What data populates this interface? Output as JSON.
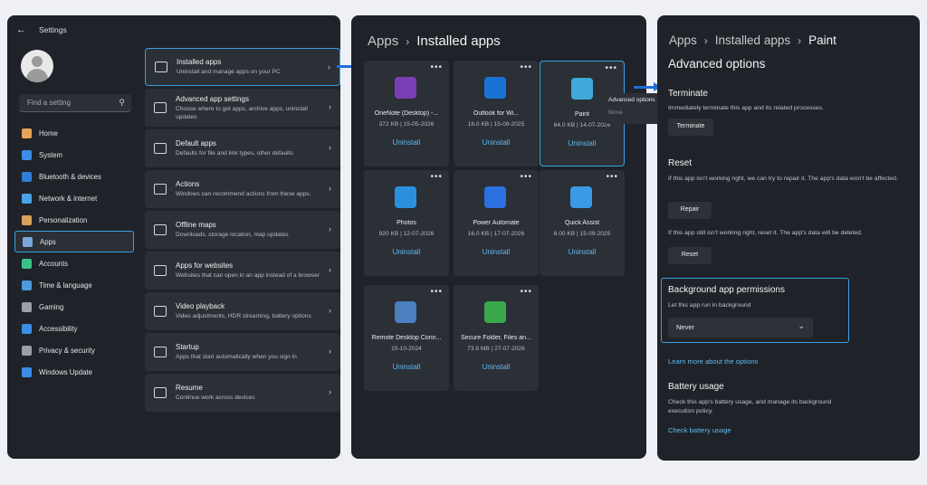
{
  "settings": {
    "back_icon": "back-arrow-icon",
    "title": "Settings",
    "search_placeholder": "Find a setting",
    "nav": [
      {
        "label": "Home",
        "icon": "home-icon",
        "color": "#e8a35a"
      },
      {
        "label": "System",
        "icon": "monitor-icon",
        "color": "#3a8ee6"
      },
      {
        "label": "Bluetooth & devices",
        "icon": "bluetooth-icon",
        "color": "#2f7fd8"
      },
      {
        "label": "Network & internet",
        "icon": "wifi-icon",
        "color": "#4aa3e8"
      },
      {
        "label": "Personalization",
        "icon": "brush-icon",
        "color": "#d9a25a"
      },
      {
        "label": "Apps",
        "icon": "apps-icon",
        "color": "#7aa6d8",
        "active": true
      },
      {
        "label": "Accounts",
        "icon": "person-icon",
        "color": "#3cc08a"
      },
      {
        "label": "Time & language",
        "icon": "globe-clock-icon",
        "color": "#4a9be0"
      },
      {
        "label": "Gaming",
        "icon": "controller-icon",
        "color": "#9aa0aa"
      },
      {
        "label": "Accessibility",
        "icon": "accessibility-icon",
        "color": "#3a8ee6"
      },
      {
        "label": "Privacy & security",
        "icon": "shield-icon",
        "color": "#9aa0aa"
      },
      {
        "label": "Windows Update",
        "icon": "update-icon",
        "color": "#3a8ee6"
      }
    ],
    "cards": [
      {
        "title": "Installed apps",
        "desc": "Uninstall and manage apps on your PC",
        "icon": "list-icon",
        "selected": true
      },
      {
        "title": "Advanced app settings",
        "desc": "Choose where to get apps, archive apps, uninstall updates",
        "icon": "app-settings-icon"
      },
      {
        "title": "Default apps",
        "desc": "Defaults for file and link types, other defaults",
        "icon": "default-apps-icon"
      },
      {
        "title": "Actions",
        "desc": "Windows can recommend actions from these apps.",
        "icon": "actions-icon"
      },
      {
        "title": "Offline maps",
        "desc": "Downloads, storage location, map updates",
        "icon": "map-icon"
      },
      {
        "title": "Apps for websites",
        "desc": "Websites that can open in an app instead of a browser",
        "icon": "web-apps-icon"
      },
      {
        "title": "Video playback",
        "desc": "Video adjustments, HDR streaming, battery options",
        "icon": "video-icon"
      },
      {
        "title": "Startup",
        "desc": "Apps that start automatically when you sign in",
        "icon": "startup-icon"
      },
      {
        "title": "Resume",
        "desc": "Continue work across devices",
        "icon": "resume-icon"
      }
    ]
  },
  "installed": {
    "breadcrumb": [
      "Apps",
      "Installed apps"
    ],
    "apps": [
      {
        "name": "OneNote (Desktop) -...",
        "meta": "372 KB | 15-05-2026",
        "action": "Uninstall",
        "icon": "onenote-icon",
        "color": "#7b3fb5"
      },
      {
        "name": "Outlook for Wi...",
        "meta": "16.0 KB | 15-09-2025",
        "action": "Uninstall",
        "icon": "outlook-icon",
        "color": "#1a73d4"
      },
      {
        "name": "Paint",
        "meta": "64.0 KB | 14-07-2026",
        "action": "Uninstall",
        "icon": "paint-icon",
        "color": "#3fa9d9",
        "selected": true
      },
      {
        "name": "Photos",
        "meta": "920 KB | 12-07-2026",
        "action": "Uninstall",
        "icon": "photos-icon",
        "color": "#2b8fe0"
      },
      {
        "name": "Power Automate",
        "meta": "16.0 KB | 17-07-2026",
        "action": "Uninstall",
        "icon": "power-automate-icon",
        "color": "#2c6fe0"
      },
      {
        "name": "Quick Assist",
        "meta": "8.00 KB | 15-09-2025",
        "action": "Uninstall",
        "icon": "quick-assist-icon",
        "color": "#3a9ae6"
      },
      {
        "name": "Remote Desktop Conn...",
        "meta": "15-10-2024",
        "action": "Uninstall",
        "icon": "remote-desktop-icon",
        "color": "#4a7fc0"
      },
      {
        "name": "Secure Folder, Files an...",
        "meta": "73.8 MB | 27-07-2026",
        "action": "Uninstall",
        "icon": "key-icon",
        "color": "#3aa84a"
      }
    ],
    "menu": [
      "Advanced options",
      "Move"
    ]
  },
  "advanced": {
    "breadcrumb": [
      "Apps",
      "Installed apps",
      "Paint"
    ],
    "heading": "Advanced options",
    "terminate": {
      "title": "Terminate",
      "text": "Immediately terminate this app and its related processes.",
      "button": "Terminate"
    },
    "reset": {
      "title": "Reset",
      "text1": "If this app isn't working right, we can try to repair it. The app's data won't be affected.",
      "repair": "Repair",
      "text2": "If this app still isn't working right, reset it. The app's data will be deleted.",
      "reset_btn": "Reset"
    },
    "background": {
      "title": "Background app permissions",
      "sub": "Let this app run in background",
      "value": "Never"
    },
    "learn_more": "Learn more about the options",
    "battery": {
      "title": "Battery usage",
      "text": "Check this app's battery usage, and manage its background execution policy.",
      "link": "Check battery usage"
    }
  }
}
